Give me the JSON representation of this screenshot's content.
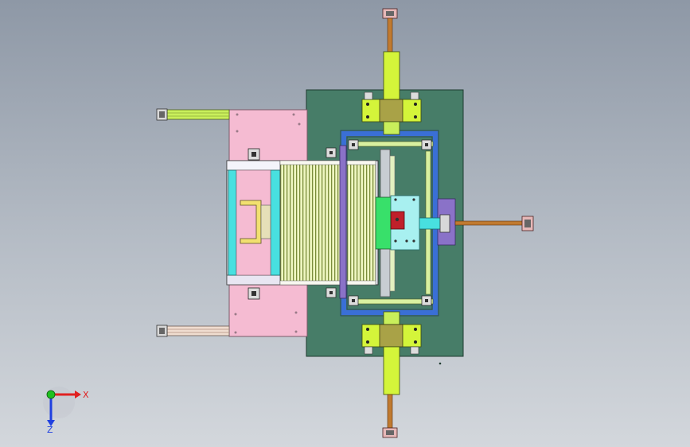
{
  "view": {
    "background_top": "#8e98a6",
    "background_bottom": "#d3d7dc"
  },
  "colors": {
    "base_plate": "#477d68",
    "pink_plate": "#f5bbd2",
    "lime": "#d4f53a",
    "cyan": "#48e0e0",
    "light_cyan": "#a8f0f0",
    "blue_frame": "#3a6fd6",
    "purple": "#8a72c8",
    "red_block": "#c0202a",
    "bronze": "#c07a30",
    "olive": "#a9a247",
    "roller_green": "#d8f0a0",
    "axis_x": "#e02020",
    "axis_y": "#20c020",
    "axis_z": "#2040e0"
  },
  "triad": {
    "x_label": "X",
    "z_label": "Z"
  }
}
